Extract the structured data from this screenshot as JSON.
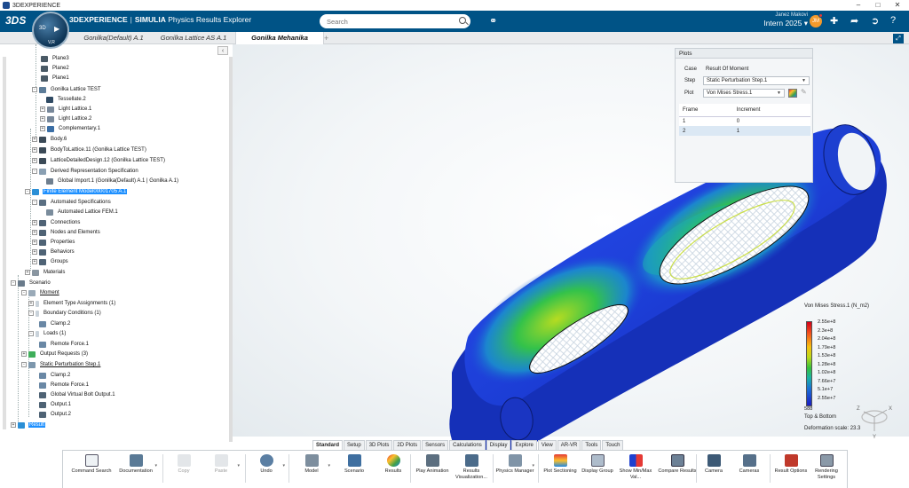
{
  "window": {
    "title": "3DEXPERIENCE"
  },
  "topbar": {
    "brand_strong": "3DEXPERIENCE",
    "brand_sep": "|",
    "brand_product": "SIMULIA",
    "brand_app": "Physics Results Explorer",
    "search_placeholder": "Search",
    "user_name": "Janez Makovi",
    "user_role": "Intern 2025",
    "avatar_initials": "JM"
  },
  "compass": {
    "label": "3D",
    "version": "V,R"
  },
  "tabs": [
    {
      "label": "Gonilka(Default) A.1"
    },
    {
      "label": "Gonilka Lattice AS A.1"
    },
    {
      "label": "Gonilka Mehanika"
    }
  ],
  "tree": {
    "nodes": [
      {
        "label": "Plane3"
      },
      {
        "label": "Plane2"
      },
      {
        "label": "Plane1"
      },
      {
        "label": "Gonilka Lattice TEST"
      },
      {
        "label": "Tessellate.2"
      },
      {
        "label": "Light Lattice.1"
      },
      {
        "label": "Light Lattice.2"
      },
      {
        "label": "Complementary.1"
      },
      {
        "label": "Body.6"
      },
      {
        "label": "BodyToLattice.11 (Gonilka Lattice TEST)"
      },
      {
        "label": "LatticeDetailedDesign.12 (Gonilka Lattice TEST)"
      },
      {
        "label": "Derived Representation Specification"
      },
      {
        "label": "Global Import.1 (Gonilka(Default) A.1 | Gonilka A.1)"
      },
      {
        "label": "Finite Element Model00001705 A.1"
      },
      {
        "label": "Automated Specifications"
      },
      {
        "label": "Automated Lattice FEM.1"
      },
      {
        "label": "Connections"
      },
      {
        "label": "Nodes and Elements"
      },
      {
        "label": "Properties"
      },
      {
        "label": "Behaviors"
      },
      {
        "label": "Groups"
      },
      {
        "label": "Materials"
      },
      {
        "label": "Scenario"
      },
      {
        "label": "Moment"
      },
      {
        "label": "Element Type Assignments (1)"
      },
      {
        "label": "Boundary Conditions (1)"
      },
      {
        "label": "Clamp.2"
      },
      {
        "label": "Loads (1)"
      },
      {
        "label": "Remote Force.1"
      },
      {
        "label": "Output Requests (3)"
      },
      {
        "label": "Static Perturbation Step.1"
      },
      {
        "label": "Clamp.2"
      },
      {
        "label": "Remote Force.1"
      },
      {
        "label": "Global Virtual Bolt Output.1"
      },
      {
        "label": "Output.1"
      },
      {
        "label": "Output.2"
      },
      {
        "label": "Result"
      }
    ]
  },
  "plots": {
    "title": "Plots",
    "case_label": "Case",
    "case_value": "Result Of Moment",
    "step_label": "Step",
    "step_value": "Static Perturbation Step.1",
    "plot_label": "Plot",
    "plot_value": "Von Mises Stress.1",
    "table": {
      "headers": [
        "Frame",
        "Increment"
      ],
      "rows": [
        [
          "1",
          "0"
        ],
        [
          "2",
          "1"
        ]
      ]
    }
  },
  "legend": {
    "title": "Von Mises Stress.1 (N_m2)",
    "values": [
      "2.55e+8",
      "2.3e+8",
      "2.04e+8",
      "1.79e+8",
      "1.53e+8",
      "1.28e+8",
      "1.02e+8",
      "7.66e+7",
      "5.1e+7",
      "2.55e+7",
      "588"
    ],
    "position_note": "Top & Bottom",
    "deformation": "Deformation scale: 23.3"
  },
  "triad": {
    "x": "X",
    "y": "Y",
    "z": "Z"
  },
  "action_tabs": [
    {
      "label": "Standard"
    },
    {
      "label": "Setup"
    },
    {
      "label": "3D Plots"
    },
    {
      "label": "2D Plots"
    },
    {
      "label": "Sensors"
    },
    {
      "label": "Calculations"
    },
    {
      "label": "Display"
    },
    {
      "label": "Explore"
    },
    {
      "label": "View"
    },
    {
      "label": "AR-VR"
    },
    {
      "label": "Tools"
    },
    {
      "label": "Touch"
    }
  ],
  "commands": [
    {
      "label": "Command Search"
    },
    {
      "label": "Documentation"
    },
    {
      "label": "Copy"
    },
    {
      "label": "Paste"
    },
    {
      "label": "Undo"
    },
    {
      "label": "Model"
    },
    {
      "label": "Scenario"
    },
    {
      "label": "Results"
    },
    {
      "label": "Play Animation"
    },
    {
      "label": "Results Visualization..."
    },
    {
      "label": "Physics Manager"
    },
    {
      "label": "Plot Sectioning"
    },
    {
      "label": "Display Group"
    },
    {
      "label": "Show Min/Max Val..."
    },
    {
      "label": "Compare Results"
    },
    {
      "label": "Camera"
    },
    {
      "label": "Cameras"
    },
    {
      "label": "Result Options"
    },
    {
      "label": "Rendering Settings"
    }
  ],
  "colors": {
    "brand": "#005386",
    "selection": "#1e90ff"
  }
}
